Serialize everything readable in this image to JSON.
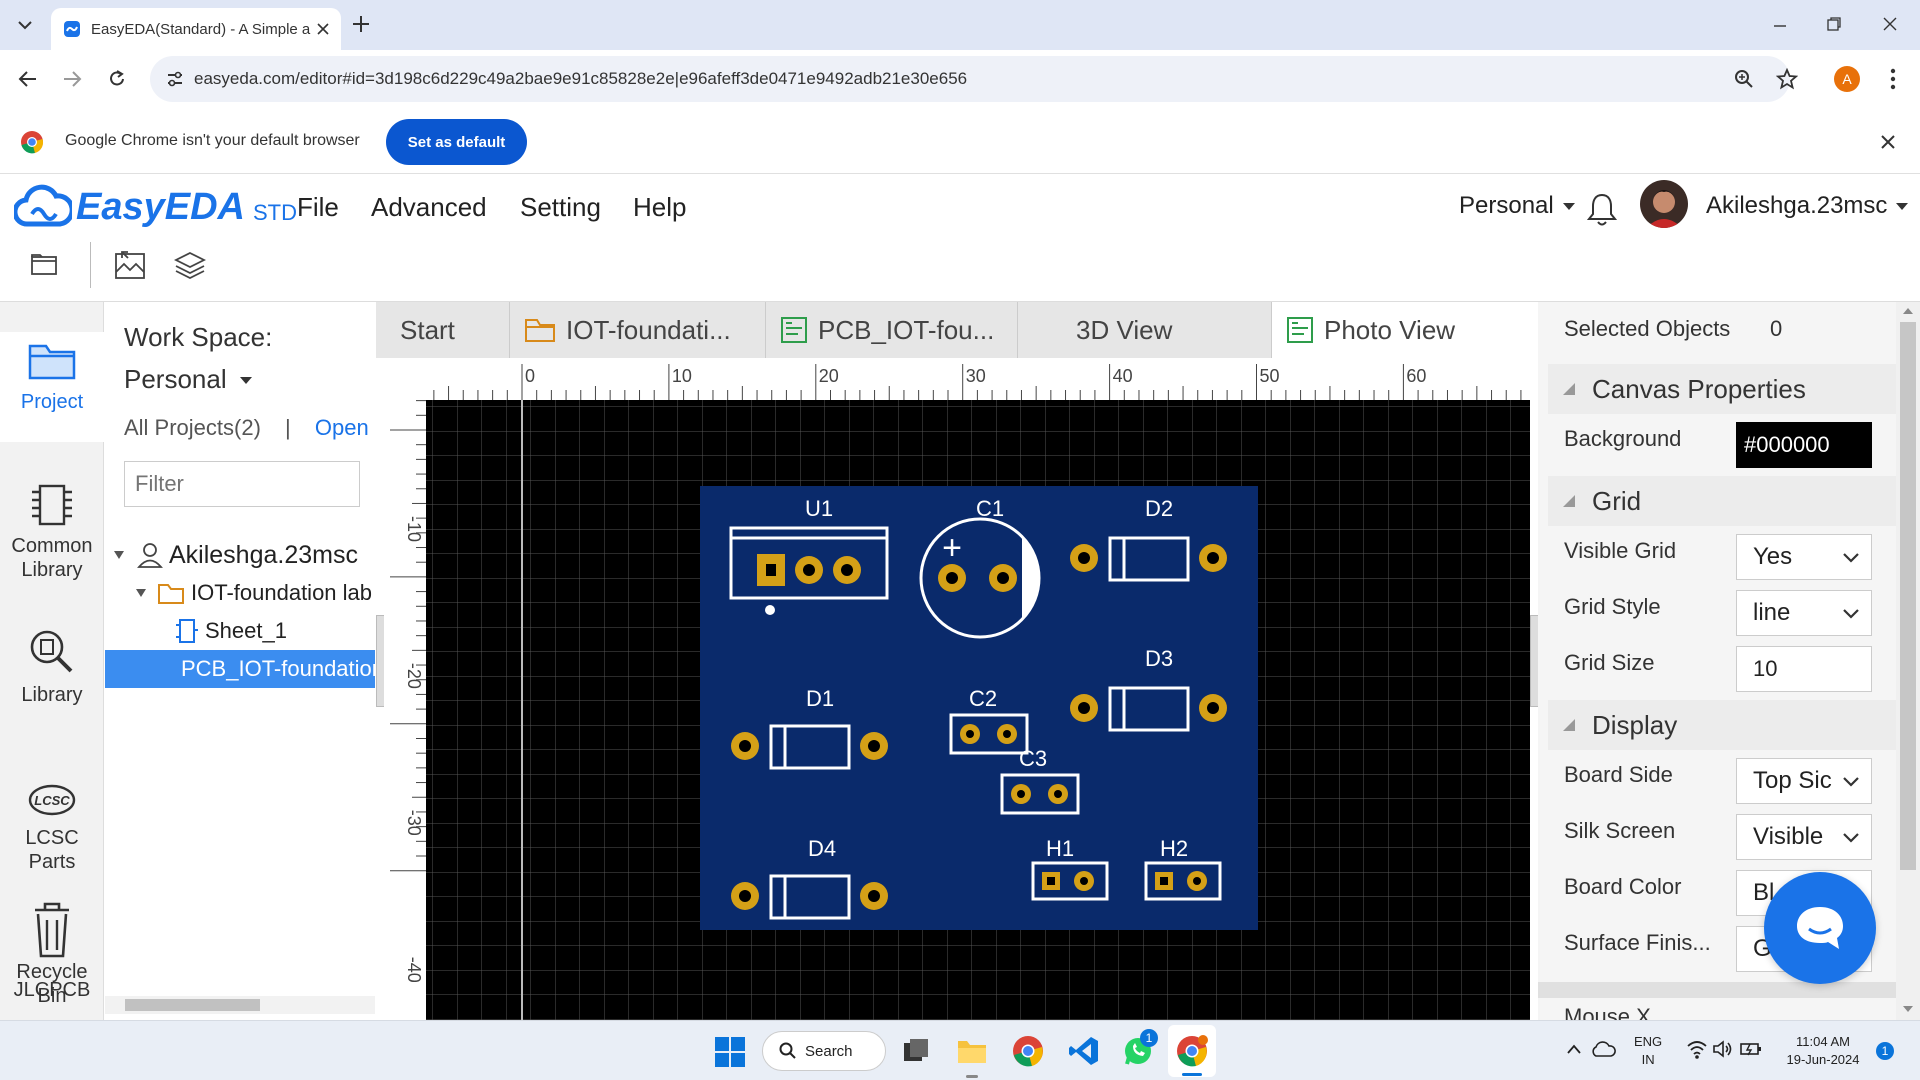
{
  "browser": {
    "tab_title": "EasyEDA(Standard) - A Simple a",
    "url": "easyeda.com/editor#id=3d198c6d229c49a2bae9e91c85828e2e|e96afeff3de0471e9492adb21e30e656",
    "profile_initial": "A",
    "infobar_text": "Google Chrome isn't your default browser",
    "set_default_label": "Set as default"
  },
  "app": {
    "logo_text": "EasyEDA",
    "logo_suffix": "STD",
    "menu": [
      "File",
      "Advanced",
      "Setting",
      "Help"
    ],
    "workspace_dropdown": "Personal",
    "username": "Akileshga.23msc",
    "accent": "#1a73e8"
  },
  "leftnav": {
    "items": [
      {
        "label": "Project",
        "icon": "folder-icon"
      },
      {
        "label": "Common\nLibrary",
        "icon": "component-icon"
      },
      {
        "label": "Library",
        "icon": "search-component-icon"
      },
      {
        "label": "LCSC\nParts",
        "icon": "lcsc-icon"
      },
      {
        "label": "JLCPCB",
        "icon": "jlcpcb-icon"
      },
      {
        "label": "Recycle\nBin",
        "icon": "trash-icon"
      }
    ]
  },
  "project": {
    "workspace_label": "Work Space:",
    "workspace_value": "Personal",
    "all_projects": "All Projects(2)",
    "separator": "|",
    "open_link": "Open",
    "filter_placeholder": "Filter",
    "tree": {
      "user": "Akileshga.23msc",
      "project": "IOT-foundation lab",
      "sheet": "Sheet_1",
      "pcb": "PCB_IOT-foundation"
    }
  },
  "tabs": [
    {
      "label": "Start"
    },
    {
      "label": "IOT-foundati..."
    },
    {
      "label": "PCB_IOT-fou..."
    },
    {
      "label": "3D View"
    },
    {
      "label": "Photo View"
    }
  ],
  "canvas": {
    "ruler_top": [
      "0",
      "10",
      "20",
      "30",
      "40",
      "50",
      "60"
    ],
    "ruler_left": [
      "-10",
      "-20",
      "-30",
      "-40"
    ],
    "board_color": "#0a2a6b",
    "components": [
      "U1",
      "C1",
      "D2",
      "D1",
      "C2",
      "D3",
      "C3",
      "D4",
      "H1",
      "H2"
    ],
    "plus_sign": "+"
  },
  "properties": {
    "selected_label": "Selected Objects",
    "selected_count": "0",
    "canvas_header": "Canvas Properties",
    "background_label": "Background",
    "background_value": "#000000",
    "grid_header": "Grid",
    "visible_grid_label": "Visible Grid",
    "visible_grid_value": "Yes",
    "grid_style_label": "Grid Style",
    "grid_style_value": "line",
    "grid_size_label": "Grid Size",
    "grid_size_value": "10",
    "display_header": "Display",
    "board_side_label": "Board Side",
    "board_side_value": "Top Sic",
    "silk_label": "Silk Screen",
    "silk_value": "Visible",
    "board_color_label": "Board Color",
    "board_color_value": "Bl",
    "surface_label": "Surface Finis...",
    "surface_value": "G",
    "mouse_label": "Mouse X"
  },
  "taskbar": {
    "search_label": "Search",
    "lang_top": "ENG",
    "lang_bottom": "IN",
    "time": "11:04 AM",
    "date": "19-Jun-2024",
    "notif_count": "1",
    "whatsapp_badge": "1"
  }
}
